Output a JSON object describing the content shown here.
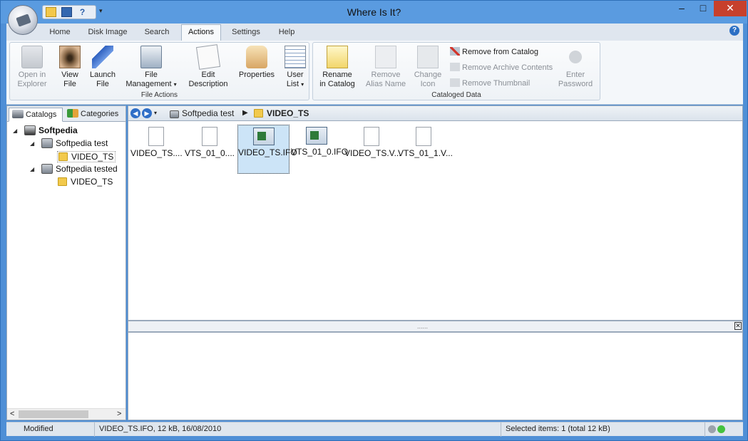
{
  "window": {
    "title": "Where Is It?",
    "minimize": "–",
    "maximize": "□",
    "close": "✕"
  },
  "quick_access": {
    "icons": [
      "open-folder-icon",
      "save-icon",
      "help-cursor-icon"
    ],
    "dropdown": "▾"
  },
  "tabs": [
    "Home",
    "Disk Image",
    "Search",
    "Actions",
    "Settings",
    "Help"
  ],
  "active_tab": "Actions",
  "help_icon": "?",
  "ribbon": {
    "file_actions": {
      "label": "File Actions",
      "buttons": [
        {
          "line1": "Open in",
          "line2": "Explorer",
          "icon": "open-in-explorer-icon",
          "enabled": false
        },
        {
          "line1": "View",
          "line2": "File",
          "icon": "eye-icon",
          "enabled": true
        },
        {
          "line1": "Launch",
          "line2": "File",
          "icon": "rocket-icon",
          "enabled": true
        },
        {
          "line1": "File",
          "line2": "Management",
          "icon": "file-management-icon",
          "enabled": true
        },
        {
          "line1": "Edit",
          "line2": "Description",
          "icon": "edit-description-icon",
          "enabled": true
        },
        {
          "line1": "Properties",
          "line2": "",
          "icon": "properties-hand-icon",
          "enabled": true
        },
        {
          "line1": "User",
          "line2": "List",
          "icon": "user-list-icon",
          "enabled": true
        }
      ]
    },
    "cataloged_data": {
      "label": "Cataloged Data",
      "buttons": [
        {
          "line1": "Rename",
          "line2": "in Catalog",
          "icon": "rename-icon",
          "enabled": true
        },
        {
          "line1": "Remove",
          "line2": "Alias Name",
          "icon": "remove-alias-icon",
          "enabled": false
        },
        {
          "line1": "Change",
          "line2": "Icon",
          "icon": "change-icon-icon",
          "enabled": false
        },
        {
          "line1": "Enter",
          "line2": "Password",
          "icon": "password-icon",
          "enabled": false
        }
      ],
      "small_buttons": [
        {
          "label": "Remove from Catalog",
          "enabled": true
        },
        {
          "label": "Remove Archive Contents",
          "enabled": false
        },
        {
          "label": "Remove Thumbnail",
          "enabled": false
        }
      ]
    }
  },
  "left_tabs": [
    "Catalogs",
    "Categories"
  ],
  "tree": {
    "root": "Softpedia",
    "volumes": [
      {
        "name": "Softpedia test",
        "folder": "VIDEO_TS"
      },
      {
        "name": "Softpedia tested",
        "folder": "VIDEO_TS"
      }
    ]
  },
  "path": {
    "volume": "Softpedia test",
    "separator": "▶",
    "folder": "VIDEO_TS"
  },
  "files": [
    {
      "name": "VIDEO_TS....",
      "type": "doc",
      "selected": false
    },
    {
      "name": "VTS_01_0....",
      "type": "doc",
      "selected": false
    },
    {
      "name": "VIDEO_TS.IFO",
      "type": "ifo",
      "selected": true
    },
    {
      "name": "VTS_01_0.IFO",
      "type": "ifo",
      "selected": false
    },
    {
      "name": "VIDEO_TS.V...",
      "type": "doc",
      "selected": false
    },
    {
      "name": "VTS_01_1.V...",
      "type": "doc",
      "selected": false
    }
  ],
  "status": {
    "modified": "Modified",
    "file_info": "VIDEO_TS.IFO, 12 kB, 16/08/2010",
    "selection": "Selected items: 1 (total 12 kB)"
  },
  "colors": {
    "selection": "#cce4f7",
    "window_frame": "#5a9be0",
    "close": "#c7402c"
  }
}
